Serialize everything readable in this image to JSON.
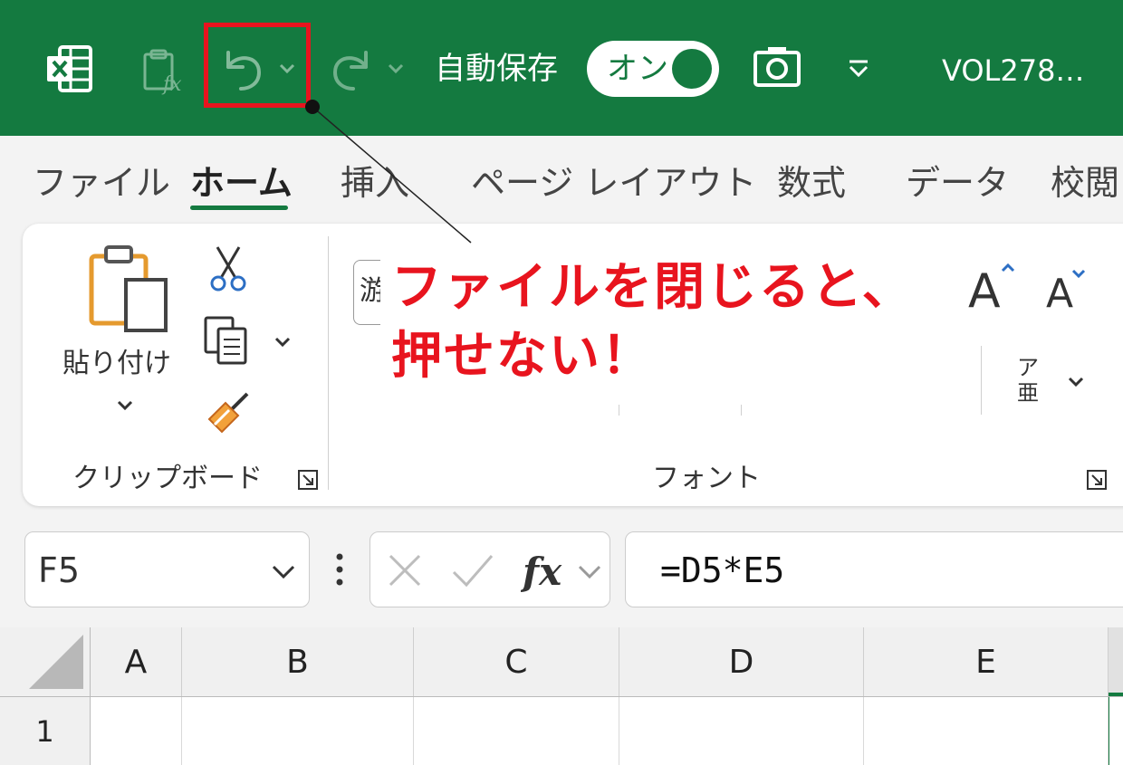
{
  "titlebar": {
    "autosave_label": "自動保存",
    "autosave_toggle": "オン",
    "filename": "VOL278…",
    "icons": [
      "excel-logo-icon",
      "paste-formula-icon",
      "undo-icon",
      "redo-icon",
      "camera-icon",
      "qat-customize-icon"
    ]
  },
  "tabs": [
    "ファイル",
    "ホーム",
    "挿入",
    "ページ レイアウト",
    "数式",
    "データ",
    "校閲"
  ],
  "ribbon": {
    "clipboard": {
      "paste_label": "貼り付け",
      "group_label": "クリップボード"
    },
    "font": {
      "group_label": "フォント",
      "font_box_fragment": "游",
      "phonetic_top": "ア",
      "phonetic_bottom": "亜"
    }
  },
  "formula_bar": {
    "name_box": "F5",
    "formula": "=D5*E5"
  },
  "grid": {
    "columns": [
      "A",
      "B",
      "C",
      "D",
      "E"
    ],
    "rows": [
      "1"
    ]
  },
  "annotation": {
    "line1": "ファイルを閉じると、",
    "line2": "押せない！",
    "color": "#e8141e"
  },
  "colors": {
    "excel_green": "#147a40",
    "highlight_red": "#e8141e"
  }
}
